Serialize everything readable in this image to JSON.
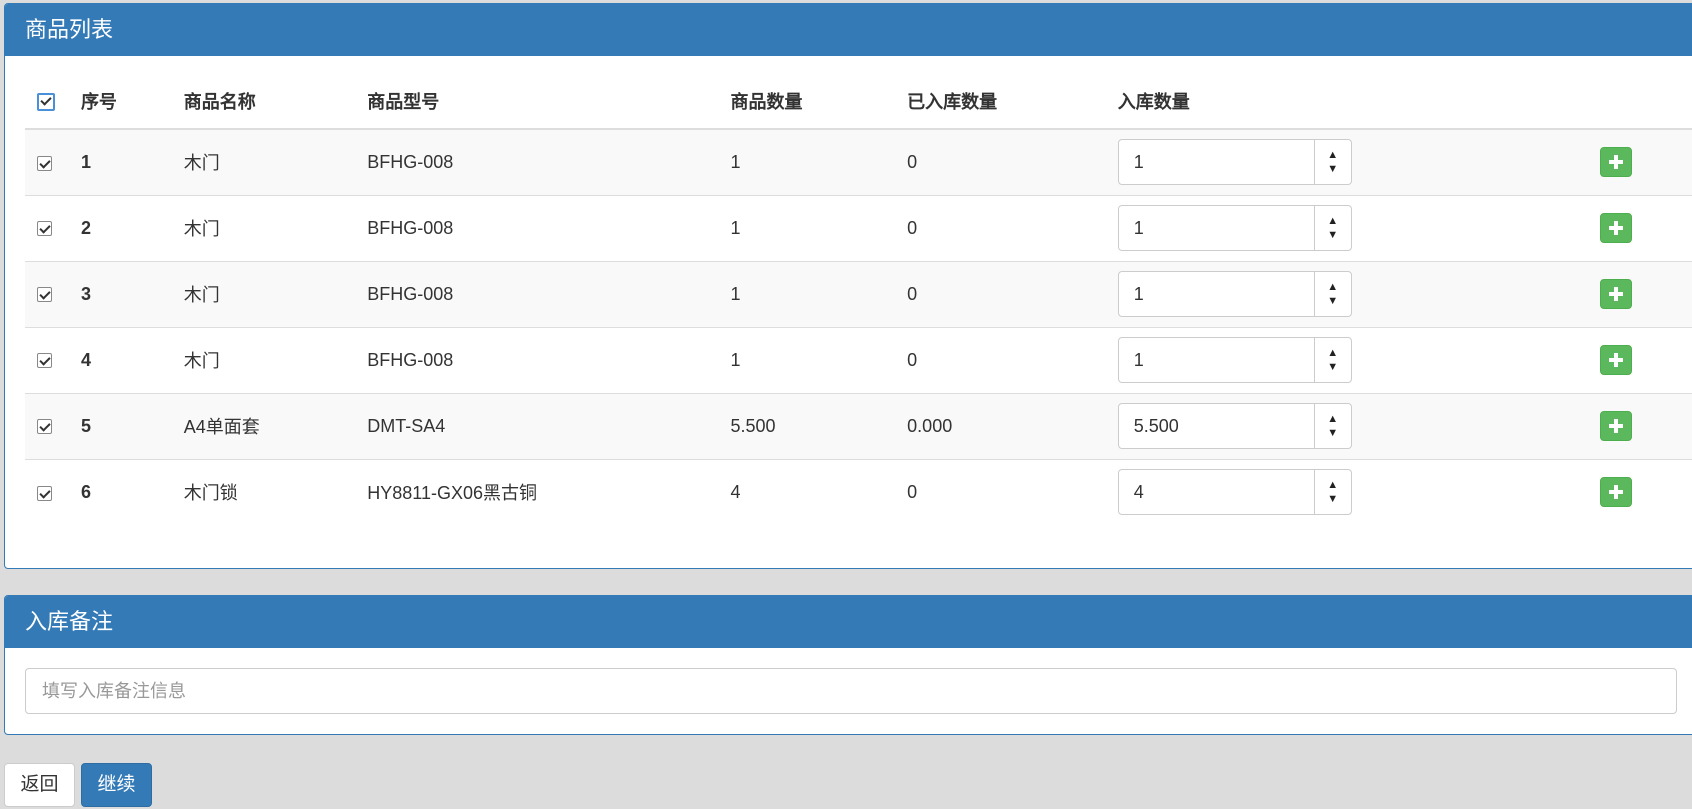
{
  "goods_panel": {
    "title": "商品列表",
    "columns": [
      "序号",
      "商品名称",
      "商品型号",
      "商品数量",
      "已入库数量",
      "入库数量"
    ],
    "rows": [
      {
        "no": "1",
        "name": "木门",
        "model": "BFHG-008",
        "qty": "1",
        "stored": "0",
        "input": "1"
      },
      {
        "no": "2",
        "name": "木门",
        "model": "BFHG-008",
        "qty": "1",
        "stored": "0",
        "input": "1"
      },
      {
        "no": "3",
        "name": "木门",
        "model": "BFHG-008",
        "qty": "1",
        "stored": "0",
        "input": "1"
      },
      {
        "no": "4",
        "name": "木门",
        "model": "BFHG-008",
        "qty": "1",
        "stored": "0",
        "input": "1"
      },
      {
        "no": "5",
        "name": "A4单面套",
        "model": "DMT-SA4",
        "qty": "5.500",
        "stored": "0.000",
        "input": "5.500"
      },
      {
        "no": "6",
        "name": "木门锁",
        "model": "HY8811-GX06黑古铜",
        "qty": "4",
        "stored": "0",
        "input": "4"
      }
    ]
  },
  "remark_panel": {
    "title": "入库备注",
    "placeholder": "填写入库备注信息",
    "value": ""
  },
  "actions": {
    "back_label": "返回",
    "continue_label": "继续"
  },
  "colors": {
    "primary": "#337ab7",
    "success": "#5cb85c",
    "page_bg": "#dcdcdc"
  },
  "icons": {
    "add": "plus-icon",
    "spinner_up": "arrow-up-icon",
    "spinner_down": "arrow-down-icon",
    "checkbox": "checkbox-checked-icon"
  }
}
